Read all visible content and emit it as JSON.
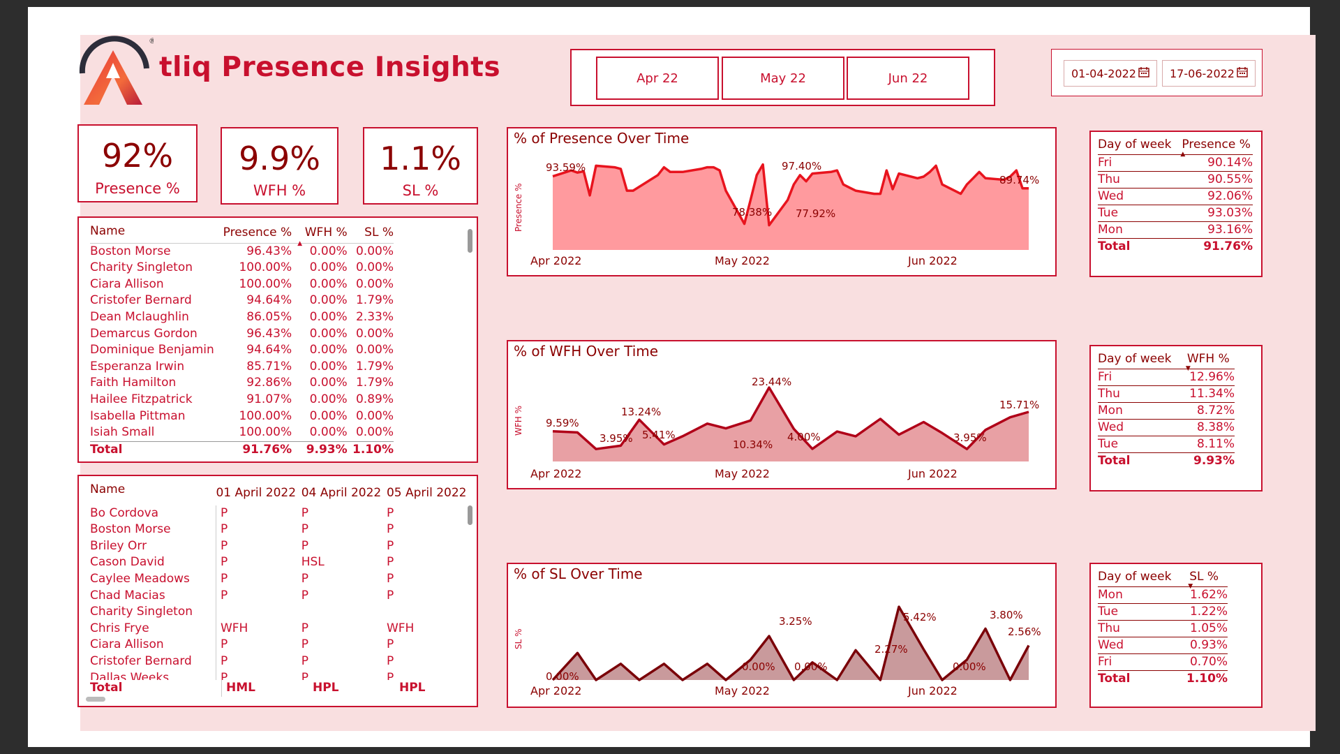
{
  "app": {
    "title": "tliq Presence Insights"
  },
  "months": [
    "Apr 22",
    "May 22",
    "Jun 22"
  ],
  "date_range": {
    "start": "01-04-2022",
    "end": "17-06-2022"
  },
  "kpis": [
    {
      "value": "92%",
      "label": "Presence %"
    },
    {
      "value": "9.9%",
      "label": "WFH %"
    },
    {
      "value": "1.1%",
      "label": "SL %"
    }
  ],
  "employees_table": {
    "headers": [
      "Name",
      "Presence %",
      "WFH %",
      "SL %"
    ],
    "rows": [
      [
        "Boston Morse",
        "96.43%",
        "0.00%",
        "0.00%"
      ],
      [
        "Charity Singleton",
        "100.00%",
        "0.00%",
        "0.00%"
      ],
      [
        "Ciara Allison",
        "100.00%",
        "0.00%",
        "0.00%"
      ],
      [
        "Cristofer Bernard",
        "94.64%",
        "0.00%",
        "1.79%"
      ],
      [
        "Dean Mclaughlin",
        "86.05%",
        "0.00%",
        "2.33%"
      ],
      [
        "Demarcus Gordon",
        "96.43%",
        "0.00%",
        "0.00%"
      ],
      [
        "Dominique Benjamin",
        "94.64%",
        "0.00%",
        "0.00%"
      ],
      [
        "Esperanza Irwin",
        "85.71%",
        "0.00%",
        "1.79%"
      ],
      [
        "Faith Hamilton",
        "92.86%",
        "0.00%",
        "1.79%"
      ],
      [
        "Hailee Fitzpatrick",
        "91.07%",
        "0.00%",
        "0.89%"
      ],
      [
        "Isabella Pittman",
        "100.00%",
        "0.00%",
        "0.00%"
      ],
      [
        "Isiah Small",
        "100.00%",
        "0.00%",
        "0.00%"
      ]
    ],
    "total": [
      "Total",
      "91.76%",
      "9.93%",
      "1.10%"
    ]
  },
  "attendance_table": {
    "headers": [
      "Name",
      "01 April 2022",
      "04 April 2022",
      "05 April 2022"
    ],
    "rows": [
      [
        "Bo Cordova",
        "P",
        "P",
        "P"
      ],
      [
        "Boston Morse",
        "P",
        "P",
        "P"
      ],
      [
        "Briley Orr",
        "P",
        "P",
        "P"
      ],
      [
        "Cason David",
        "P",
        "HSL",
        "P"
      ],
      [
        "Caylee Meadows",
        "P",
        "P",
        "P"
      ],
      [
        "Chad Macias",
        "P",
        "P",
        "P"
      ],
      [
        "Charity Singleton",
        "",
        "",
        ""
      ],
      [
        "Chris Frye",
        "WFH",
        "P",
        "WFH"
      ],
      [
        "Ciara Allison",
        "P",
        "P",
        "P"
      ],
      [
        "Cristofer Bernard",
        "P",
        "P",
        "P"
      ],
      [
        "Dallas Weeks",
        "P",
        "P",
        "P"
      ]
    ],
    "total": [
      "Total",
      "HML",
      "HPL",
      "HPL"
    ]
  },
  "charts": {
    "presence": {
      "title": "% of Presence Over Time",
      "ylabel": "Presence %",
      "xticks": [
        "Apr 2022",
        "May 2022",
        "Jun 2022"
      ],
      "labels": [
        "93.59%",
        "97.40%",
        "78.38%",
        "77.92%",
        "89.74%"
      ]
    },
    "wfh": {
      "title": "% of WFH Over Time",
      "ylabel": "WFH %",
      "xticks": [
        "Apr 2022",
        "May 2022",
        "Jun 2022"
      ],
      "labels": [
        "9.59%",
        "3.95%",
        "13.24%",
        "5.41%",
        "23.44%",
        "10.34%",
        "4.00%",
        "3.95%",
        "15.71%"
      ]
    },
    "sl": {
      "title": "% of SL Over Time",
      "ylabel": "SL %",
      "xticks": [
        "Apr 2022",
        "May 2022",
        "Jun 2022"
      ],
      "labels": [
        "0.00%",
        "3.25%",
        "0.00%",
        "0.00%",
        "5.42%",
        "2.27%",
        "0.00%",
        "3.80%",
        "2.56%"
      ]
    }
  },
  "chart_data": [
    {
      "type": "area",
      "title": "% of Presence Over Time",
      "ylabel": "Presence %",
      "xlabel": "",
      "x": [
        "2022-04-01",
        "2022-04-04",
        "2022-04-05",
        "2022-04-06",
        "2022-04-07",
        "2022-04-08",
        "2022-04-11",
        "2022-04-12",
        "2022-04-13",
        "2022-04-14",
        "2022-04-18",
        "2022-04-19",
        "2022-04-20",
        "2022-04-21",
        "2022-04-22",
        "2022-04-25",
        "2022-04-26",
        "2022-04-27",
        "2022-04-28",
        "2022-04-29",
        "2022-05-02",
        "2022-05-03",
        "2022-05-04",
        "2022-05-05",
        "2022-05-06",
        "2022-05-09",
        "2022-05-10",
        "2022-05-11",
        "2022-05-12",
        "2022-05-13",
        "2022-05-16",
        "2022-05-17",
        "2022-05-18",
        "2022-05-19",
        "2022-05-20",
        "2022-05-23",
        "2022-05-24",
        "2022-05-25",
        "2022-05-26",
        "2022-05-27",
        "2022-05-30",
        "2022-05-31",
        "2022-06-01",
        "2022-06-02",
        "2022-06-03",
        "2022-06-06",
        "2022-06-07",
        "2022-06-08",
        "2022-06-09",
        "2022-06-10",
        "2022-06-13",
        "2022-06-14",
        "2022-06-15",
        "2022-06-16",
        "2022-06-17"
      ],
      "values": [
        93.59,
        95.5,
        94.8,
        95.2,
        87.5,
        97.0,
        96.5,
        96.0,
        89.0,
        89.0,
        94.0,
        96.5,
        95.0,
        95.0,
        95.0,
        96.0,
        96.5,
        96.5,
        95.5,
        89.0,
        78.38,
        86.0,
        94.0,
        97.4,
        77.92,
        86.0,
        91.0,
        94.0,
        92.0,
        94.5,
        95.0,
        95.5,
        91.0,
        90.0,
        89.0,
        88.0,
        88.0,
        95.5,
        89.5,
        94.5,
        93.0,
        93.5,
        95.0,
        97.0,
        91.0,
        88.0,
        91.0,
        93.0,
        95.0,
        93.0,
        92.5,
        93.5,
        95.5,
        89.74,
        89.74
      ]
    },
    {
      "type": "area",
      "title": "% of WFH Over Time",
      "ylabel": "WFH %",
      "xlabel": "",
      "x": [
        "2022-04-01",
        "2022-04-05",
        "2022-04-08",
        "2022-04-12",
        "2022-04-15",
        "2022-04-19",
        "2022-04-22",
        "2022-04-26",
        "2022-04-29",
        "2022-05-03",
        "2022-05-06",
        "2022-05-10",
        "2022-05-13",
        "2022-05-17",
        "2022-05-20",
        "2022-05-24",
        "2022-05-27",
        "2022-05-31",
        "2022-06-03",
        "2022-06-07",
        "2022-06-10",
        "2022-06-14",
        "2022-06-17"
      ],
      "values": [
        9.59,
        9.2,
        3.95,
        5.0,
        13.24,
        5.41,
        8.0,
        12.0,
        10.5,
        13.0,
        23.44,
        10.34,
        4.0,
        9.5,
        8.0,
        13.5,
        8.5,
        12.5,
        9.0,
        3.95,
        10.0,
        14.0,
        15.71
      ]
    },
    {
      "type": "area",
      "title": "% of SL Over Time",
      "ylabel": "SL %",
      "xlabel": "",
      "x": [
        "2022-04-01",
        "2022-04-05",
        "2022-04-08",
        "2022-04-12",
        "2022-04-15",
        "2022-04-19",
        "2022-04-22",
        "2022-04-26",
        "2022-04-29",
        "2022-05-03",
        "2022-05-06",
        "2022-05-10",
        "2022-05-13",
        "2022-05-17",
        "2022-05-20",
        "2022-05-24",
        "2022-05-27",
        "2022-05-31",
        "2022-06-03",
        "2022-06-07",
        "2022-06-10",
        "2022-06-14",
        "2022-06-17"
      ],
      "values": [
        0.0,
        2.0,
        0.0,
        1.2,
        0.0,
        1.2,
        0.0,
        1.2,
        0.0,
        1.5,
        3.25,
        0.0,
        1.3,
        0.0,
        2.2,
        0.0,
        5.42,
        2.27,
        0.0,
        1.5,
        3.8,
        0.0,
        2.56
      ]
    }
  ],
  "dow_tables": [
    {
      "headers": [
        "Day of week",
        "Presence %"
      ],
      "rows": [
        [
          "Fri",
          "90.14%"
        ],
        [
          "Thu",
          "90.55%"
        ],
        [
          "Wed",
          "92.06%"
        ],
        [
          "Tue",
          "93.03%"
        ],
        [
          "Mon",
          "93.16%"
        ]
      ],
      "total": [
        "Total",
        "91.76%"
      ]
    },
    {
      "headers": [
        "Day of week",
        "WFH %"
      ],
      "rows": [
        [
          "Fri",
          "12.96%"
        ],
        [
          "Thu",
          "11.34%"
        ],
        [
          "Mon",
          "8.72%"
        ],
        [
          "Wed",
          "8.38%"
        ],
        [
          "Tue",
          "8.11%"
        ]
      ],
      "total": [
        "Total",
        "9.93%"
      ]
    },
    {
      "headers": [
        "Day of week",
        "SL %"
      ],
      "rows": [
        [
          "Mon",
          "1.62%"
        ],
        [
          "Tue",
          "1.22%"
        ],
        [
          "Thu",
          "1.05%"
        ],
        [
          "Wed",
          "0.93%"
        ],
        [
          "Fri",
          "0.70%"
        ]
      ],
      "total": [
        "Total",
        "1.10%"
      ]
    }
  ],
  "colors": {
    "accent": "#c8102e",
    "dark": "#8b0000",
    "canvas": "#f9dfe0",
    "presence_fill": "#ff9a9e",
    "wfh_fill": "#e8a0a4",
    "sl_fill": "#c99a9c"
  }
}
